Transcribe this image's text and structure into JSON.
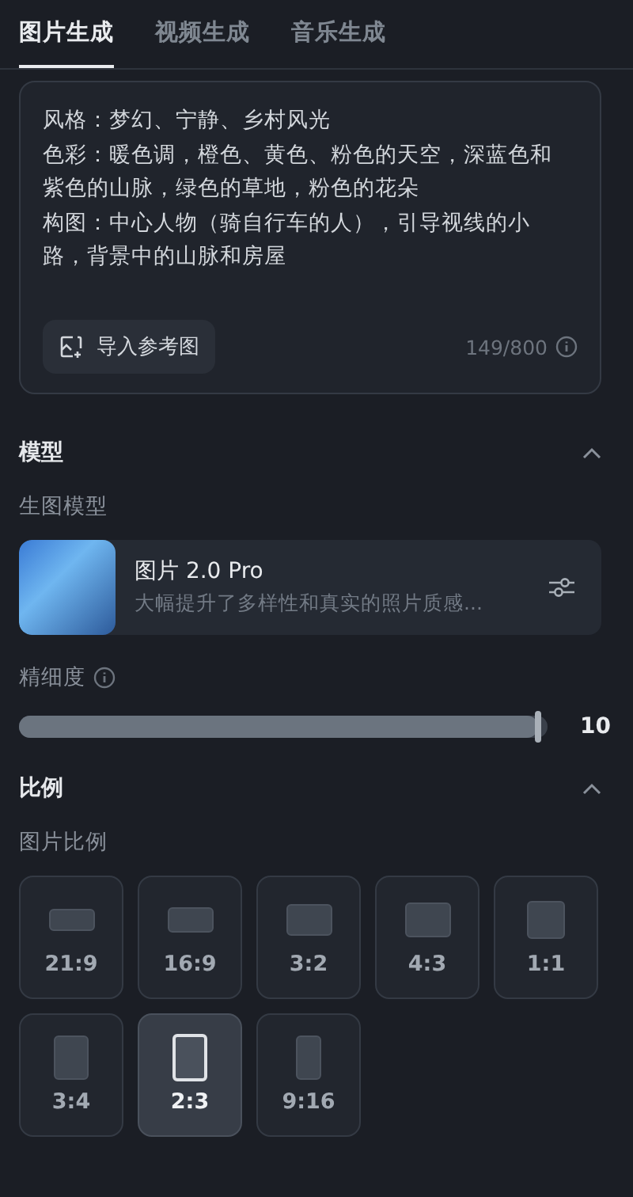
{
  "tabs": [
    {
      "label": "图片生成",
      "selected": true
    },
    {
      "label": "视频生成",
      "selected": false
    },
    {
      "label": "音乐生成",
      "selected": false
    }
  ],
  "prompt": {
    "lines": [
      "风格：梦幻、宁静、乡村风光",
      "色彩：暖色调，橙色、黄色、粉色的天空，深蓝色和紫色的山脉，绿色的草地，粉色的花朵",
      "构图：中心人物（骑自行车的人），引导视线的小路，背景中的山脉和房屋"
    ],
    "import_button": "导入参考图",
    "counter": "149/800"
  },
  "model_section": {
    "title": "模型",
    "expanded": true,
    "label": "生图模型",
    "model": {
      "name": "图片 2.0 Pro",
      "description": "大幅提升了多样性和真实的照片质感..."
    }
  },
  "detail": {
    "label": "精细度",
    "level": 1.0,
    "reading": "10"
  },
  "ratio_section": {
    "title": "比例",
    "expanded": true,
    "label": "图片比例",
    "ratios": [
      {
        "label": "21:9",
        "selected": false
      },
      {
        "label": "16:9",
        "selected": false
      },
      {
        "label": "3:2",
        "selected": false
      },
      {
        "label": "4:3",
        "selected": false
      },
      {
        "label": "1:1",
        "selected": false
      },
      {
        "label": "3:4",
        "selected": false
      },
      {
        "label": "2:3",
        "selected": true
      },
      {
        "label": "9:16",
        "selected": false
      }
    ]
  }
}
